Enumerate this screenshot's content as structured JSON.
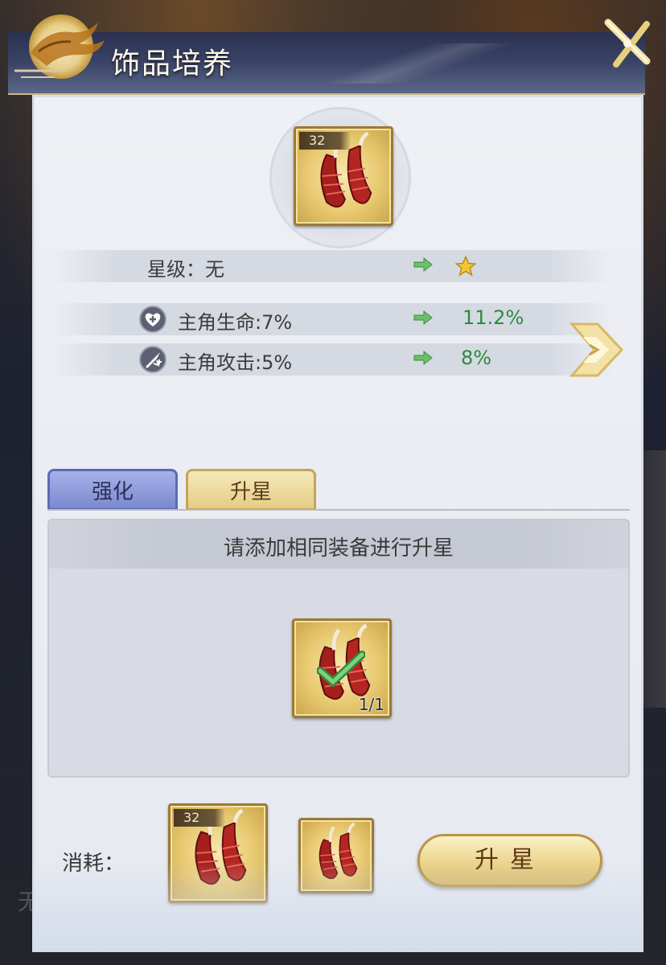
{
  "header": {
    "title": "饰品培养",
    "close_icon": "close-x-icon",
    "emblem_icon": "dragon-emblem-icon"
  },
  "item": {
    "level": "32",
    "icon": "red-horn-accessory-icon"
  },
  "stats": {
    "star": {
      "label": "星级：无",
      "next_icon": "gold-star-icon"
    },
    "hp": {
      "icon": "heart-plus-icon",
      "label": "主角生命:7%",
      "value": "11.2%"
    },
    "atk": {
      "icon": "sword-attack-icon",
      "label": "主角攻击:5%",
      "value": "8%"
    },
    "arrow_icon": "green-arrow-icon",
    "value_color": "#2f8a3c"
  },
  "tabs": {
    "enhance": "强化",
    "starup": "升星"
  },
  "starup_panel": {
    "hint": "请添加相同装备进行升星",
    "material_count": "1/1",
    "check_icon": "green-check-icon"
  },
  "consume": {
    "label": "消耗：",
    "item_level": "32",
    "button": "升星"
  },
  "next_icon": "next-chevron-icon",
  "backdrop_text": "无"
}
